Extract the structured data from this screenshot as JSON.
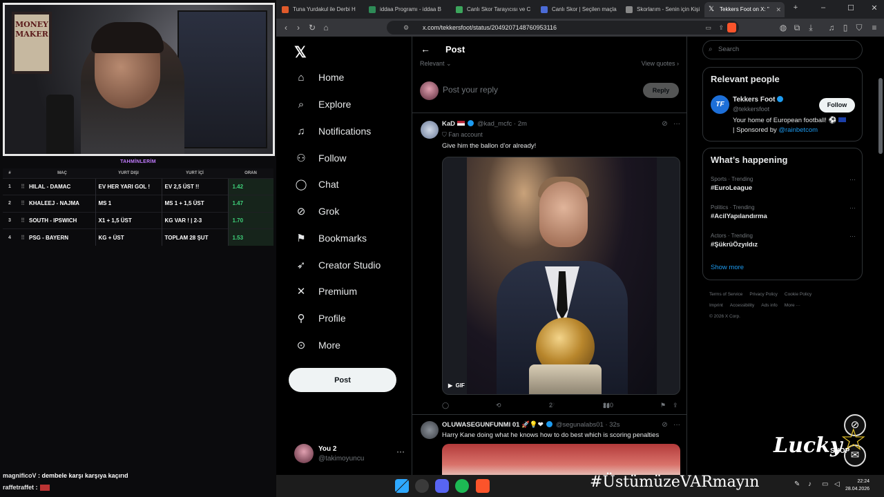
{
  "stream": {
    "predict_title": "TAHMİNLERİM",
    "table_headers": [
      "#",
      "MAÇ",
      "YURT DIŞI",
      "YURT İÇİ",
      "ORAN"
    ],
    "rows": [
      {
        "num": "1",
        "match": "HILAL - DAMAC",
        "away": "EV HER YARI GOL !",
        "home": "EV 2,5 ÜST !!",
        "odds": "1.42"
      },
      {
        "num": "2",
        "match": "KHALEEJ - NAJMA",
        "away": "MS 1",
        "home": "MS 1 + 1,5 ÜST",
        "odds": "1.47"
      },
      {
        "num": "3",
        "match": "SOUTH - IPSWICH",
        "away": "X1 + 1,5 ÜST",
        "home": "KG VAR ! | 2-3",
        "odds": "1.70"
      },
      {
        "num": "4",
        "match": "PSG - BAYERN",
        "away": "KG + ÜST",
        "home": "TOPLAM 28 ŞUT",
        "odds": "1.53"
      }
    ],
    "chat": [
      {
        "user": "magnificoV",
        "text": " : dembele karşı karşıya kaçırıd"
      },
      {
        "user": "raffetraffet",
        "text": " :"
      }
    ],
    "poster_text": "MONEY MAKER"
  },
  "browser": {
    "tabs": [
      {
        "label": "Tuna Yurdakul ile Derbi H",
        "icon_color": "#e05a2b"
      },
      {
        "label": "iddaa Programı - iddaa B",
        "icon_color": "#2e8b57"
      },
      {
        "label": "Canlı Skor Tarayıcısı ve C",
        "icon_color": "#3ca55c"
      },
      {
        "label": "Canlı Skor | Seçilen maçla",
        "icon_color": "#4b6bd6"
      },
      {
        "label": "Skorlarım - Senin için Kişi",
        "icon_color": "#888888"
      },
      {
        "label": "Tekkers Foot on X: \"",
        "icon_color": "#ffffff"
      }
    ],
    "url": "x.com/tekkersfoot/status/2049207148760953116"
  },
  "nav": {
    "items": [
      {
        "label": "Home",
        "icon": "home-icon"
      },
      {
        "label": "Explore",
        "icon": "search-icon"
      },
      {
        "label": "Notifications",
        "icon": "bell-icon"
      },
      {
        "label": "Follow",
        "icon": "add-person-icon"
      },
      {
        "label": "Chat",
        "icon": "chat-icon"
      },
      {
        "label": "Grok",
        "icon": "grok-icon"
      },
      {
        "label": "Bookmarks",
        "icon": "bookmark-icon"
      },
      {
        "label": "Creator Studio",
        "icon": "rocket-icon"
      },
      {
        "label": "Premium",
        "icon": "x-icon"
      },
      {
        "label": "Profile",
        "icon": "person-icon"
      },
      {
        "label": "More",
        "icon": "more-circle-icon"
      }
    ],
    "post_label": "Post",
    "account_name": "You 2",
    "account_handle": "@takimoyuncu"
  },
  "main": {
    "title": "Post",
    "sort_label": "Relevant",
    "quotes_label": "View quotes",
    "reply_placeholder": "Post your reply",
    "reply_button": "Reply",
    "tweets": [
      {
        "name": "KaD",
        "handle": "@kad_mcfc",
        "time": "· 2m",
        "badge": "Fan account",
        "text": "Give him the ballon d’or already!",
        "media_label": "GIF",
        "replies": "",
        "reposts": "",
        "likes": "2",
        "views": "240"
      },
      {
        "name": "OLUWASEGUNFUNMI 01",
        "handle": "@segunalabs01",
        "time": "· 32s",
        "text": "Harry Kane doing what he knows how to do best which is scoring penalties"
      }
    ]
  },
  "sidebar": {
    "search_placeholder": "Search",
    "relevant_title": "Relevant people",
    "person": {
      "name": "Tekkers Foot",
      "handle": "@tekkersfoot",
      "bio": "Your home of European football!",
      "bio_sponsor": "| Sponsored by ",
      "bio_link": "@rainbetcom",
      "follow_label": "Follow",
      "avatar_text": "TF"
    },
    "happening_title": "What’s happening",
    "trends": [
      {
        "category": "Sports · Trending",
        "tag": "#EuroLeague"
      },
      {
        "category": "Politics · Trending",
        "tag": "#AcilYapılandırma"
      },
      {
        "category": "Actors · Trending",
        "tag": "#ŞükrüÖzyıldız"
      }
    ],
    "show_more": "Show more",
    "footer": [
      "Terms of Service",
      "Privacy Policy",
      "Cookie Policy",
      "Imprint",
      "Accessibility",
      "Ads info",
      "More ···",
      "© 2026 X Corp."
    ]
  },
  "overlay": {
    "hashtag": "#ÜstümüzeVARmayın",
    "brand": "Lucky",
    "brand_sub": "SHOP"
  },
  "taskbar": {
    "time": "22:24",
    "date": "28.04.2026"
  }
}
